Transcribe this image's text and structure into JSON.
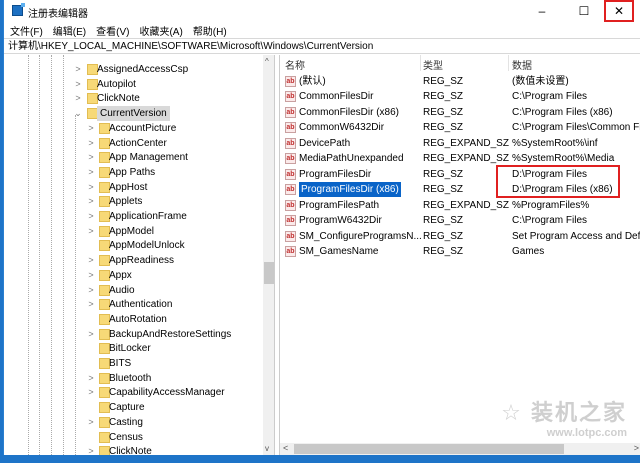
{
  "window": {
    "title": "注册表编辑器",
    "minimize": "–",
    "maximize": "☐",
    "close": "✕"
  },
  "menu": [
    "文件(F)",
    "编辑(E)",
    "查看(V)",
    "收藏夹(A)",
    "帮助(H)"
  ],
  "address": "计算机\\HKEY_LOCAL_MACHINE\\SOFTWARE\\Microsoft\\Windows\\CurrentVersion",
  "tree": {
    "top": [
      {
        "label": "AssignedAccessCsp",
        "chev": ">"
      },
      {
        "label": "Autopilot",
        "chev": ">"
      },
      {
        "label": "ClickNote",
        "chev": ">"
      },
      {
        "label": "CurrentVersion",
        "chev": "v",
        "selected": true
      }
    ],
    "children": [
      {
        "label": "AccountPicture",
        "chev": ">"
      },
      {
        "label": "ActionCenter",
        "chev": ">"
      },
      {
        "label": "App Management",
        "chev": ">"
      },
      {
        "label": "App Paths",
        "chev": ">"
      },
      {
        "label": "AppHost",
        "chev": ">"
      },
      {
        "label": "Applets",
        "chev": ">"
      },
      {
        "label": "ApplicationFrame",
        "chev": ">"
      },
      {
        "label": "AppModel",
        "chev": ">"
      },
      {
        "label": "AppModelUnlock",
        "chev": ""
      },
      {
        "label": "AppReadiness",
        "chev": ">"
      },
      {
        "label": "Appx",
        "chev": ">"
      },
      {
        "label": "Audio",
        "chev": ">"
      },
      {
        "label": "Authentication",
        "chev": ">"
      },
      {
        "label": "AutoRotation",
        "chev": ""
      },
      {
        "label": "BackupAndRestoreSettings",
        "chev": ">"
      },
      {
        "label": "BitLocker",
        "chev": ""
      },
      {
        "label": "BITS",
        "chev": ""
      },
      {
        "label": "Bluetooth",
        "chev": ">"
      },
      {
        "label": "CapabilityAccessManager",
        "chev": ">"
      },
      {
        "label": "Capture",
        "chev": ""
      },
      {
        "label": "Casting",
        "chev": ">"
      },
      {
        "label": "Census",
        "chev": ""
      },
      {
        "label": "ClickNote",
        "chev": ">"
      }
    ]
  },
  "columns": {
    "name": "名称",
    "type": "类型",
    "data": "数据"
  },
  "values": [
    {
      "name": "(默认)",
      "type": "REG_SZ",
      "data": "(数值未设置)"
    },
    {
      "name": "CommonFilesDir",
      "type": "REG_SZ",
      "data": "C:\\Program Files"
    },
    {
      "name": "CommonFilesDir (x86)",
      "type": "REG_SZ",
      "data": "C:\\Program Files (x86)"
    },
    {
      "name": "CommonW6432Dir",
      "type": "REG_SZ",
      "data": "C:\\Program Files\\Common Fil"
    },
    {
      "name": "DevicePath",
      "type": "REG_EXPAND_SZ",
      "data": "%SystemRoot%\\inf"
    },
    {
      "name": "MediaPathUnexpanded",
      "type": "REG_EXPAND_SZ",
      "data": "%SystemRoot%\\Media"
    },
    {
      "name": "ProgramFilesDir",
      "type": "REG_SZ",
      "data": "D:\\Program Files"
    },
    {
      "name": "ProgramFilesDir (x86)",
      "type": "REG_SZ",
      "data": "D:\\Program Files (x86)",
      "selected": true
    },
    {
      "name": "ProgramFilesPath",
      "type": "REG_EXPAND_SZ",
      "data": "%ProgramFiles%"
    },
    {
      "name": "ProgramW6432Dir",
      "type": "REG_SZ",
      "data": "C:\\Program Files"
    },
    {
      "name": "SM_ConfigureProgramsN...",
      "type": "REG_SZ",
      "data": "Set Program Access and Defa"
    },
    {
      "name": "SM_GamesName",
      "type": "REG_SZ",
      "data": "Games"
    }
  ],
  "watermark": {
    "name": "装机之家",
    "url": "www.lotpc.com"
  },
  "colors": {
    "selection": "#0a64c8",
    "highlight_box": "#e02020",
    "folder": "#f7d977"
  }
}
